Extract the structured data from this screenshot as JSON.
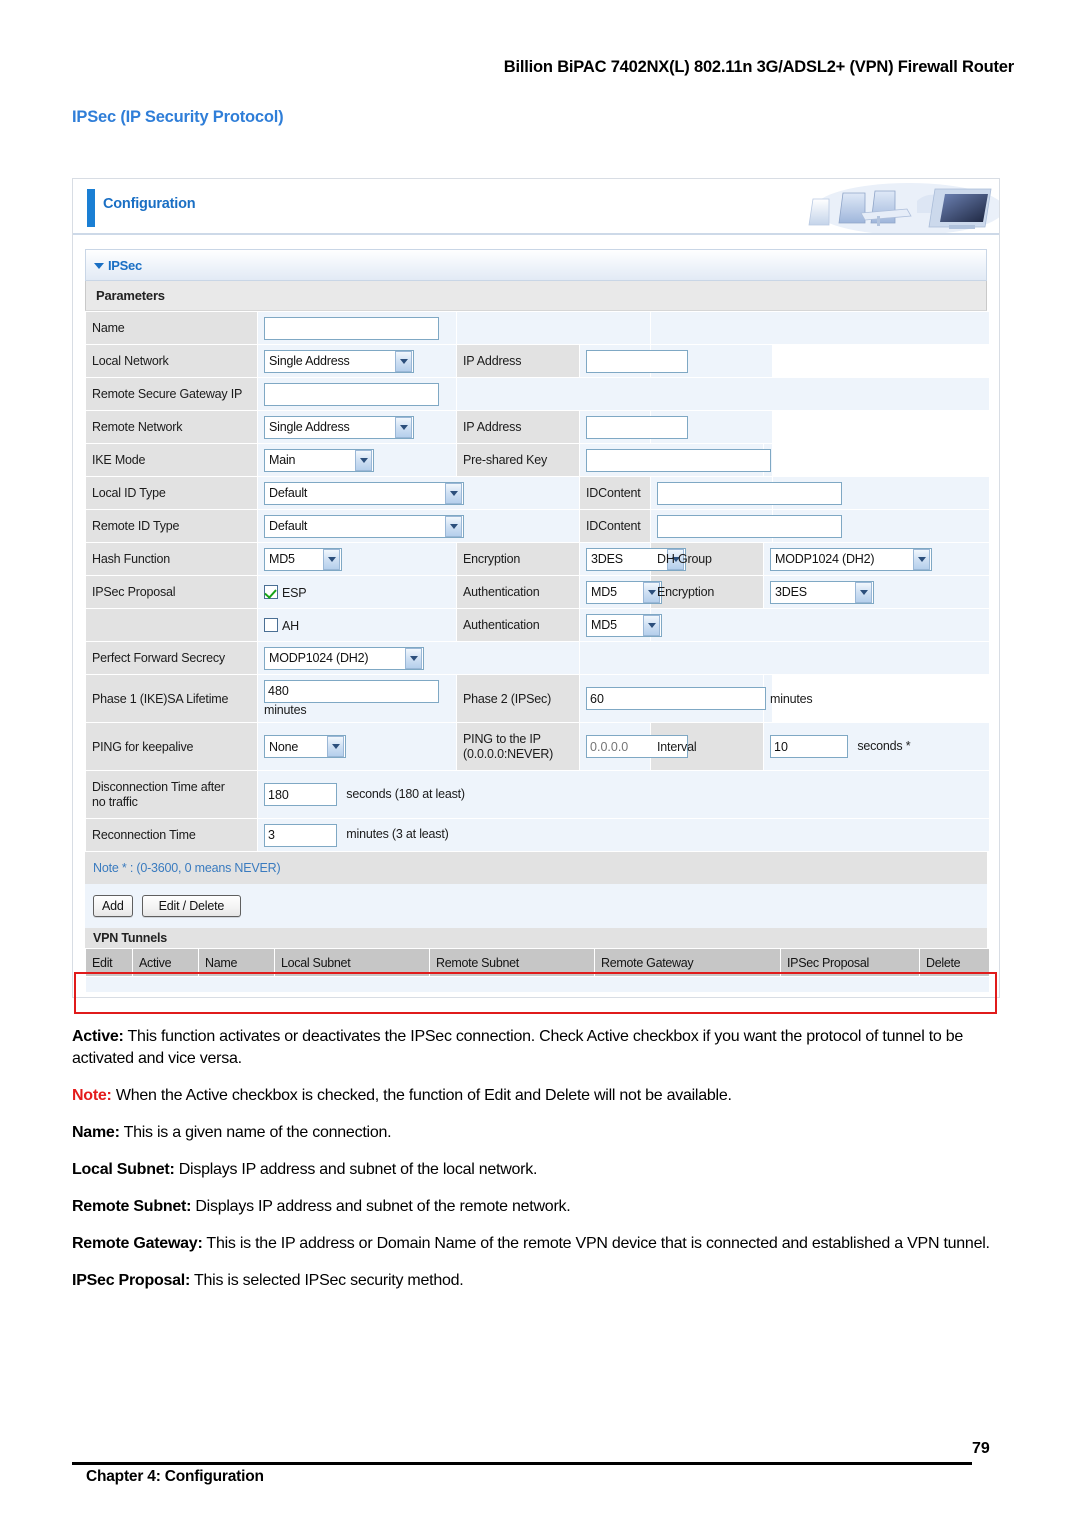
{
  "page": {
    "header_title": "Billion BiPAC 7402NX(L) 802.11n 3G/ADSL2+ (VPN) Firewall Router",
    "section_title": "IPSec (IP Security Protocol)",
    "footer_chapter": "Chapter 4: Configuration",
    "footer_page": "79"
  },
  "panel": {
    "config_label": "Configuration",
    "ipsec_label": "IPSec",
    "parameters_label": "Parameters",
    "note_label": "Note * : (0-3600, 0 means NEVER)",
    "tunnels_label": "VPN Tunnels"
  },
  "form": {
    "name": {
      "label": "Name",
      "value": ""
    },
    "local_network": {
      "label": "Local Network",
      "select_value": "Single Address",
      "ip_label": "IP Address",
      "ip_value": ""
    },
    "remote_secure_gateway_ip": {
      "label": "Remote Secure Gateway IP",
      "value": ""
    },
    "remote_network": {
      "label": "Remote Network",
      "select_value": "Single Address",
      "ip_label": "IP Address",
      "ip_value": ""
    },
    "ike_mode": {
      "label": "IKE Mode",
      "select_value": "Main",
      "psk_label": "Pre-shared Key",
      "psk_value": ""
    },
    "local_id_type": {
      "label": "Local ID Type",
      "select_value": "Default",
      "idcontent_label": "IDContent",
      "idcontent_value": ""
    },
    "remote_id_type": {
      "label": "Remote ID Type",
      "select_value": "Default",
      "idcontent_label": "IDContent",
      "idcontent_value": ""
    },
    "hash_function": {
      "label": "Hash Function",
      "select_value": "MD5",
      "encryption_label": "Encryption",
      "encryption_value": "3DES",
      "dh_group_label": "DH Group",
      "dh_group_value": "MODP1024 (DH2)"
    },
    "ipsec_proposal": {
      "label": "IPSec Proposal",
      "esp_label": "ESP",
      "esp_checked": true,
      "esp_auth_label": "Authentication",
      "esp_auth_value": "MD5",
      "esp_enc_label": "Encryption",
      "esp_enc_value": "3DES",
      "ah_label": "AH",
      "ah_checked": false,
      "ah_auth_label": "Authentication",
      "ah_auth_value": "MD5"
    },
    "pfs": {
      "label": "Perfect Forward Secrecy",
      "select_value": "MODP1024 (DH2)"
    },
    "phase1": {
      "label": "Phase 1 (IKE)SA Lifetime",
      "value": "480",
      "unit": "minutes",
      "phase2_label": "Phase 2 (IPSec)",
      "phase2_value": "60",
      "phase2_unit": "minutes"
    },
    "ping_keepalive": {
      "label": "PING for keepalive",
      "select_value": "None",
      "ping_ip_label_line1": "PING to the IP",
      "ping_ip_label_line2": "(0.0.0.0:NEVER)",
      "ping_ip_placeholder": "0.0.0.0",
      "ping_ip_value": "",
      "interval_label": "Interval",
      "interval_value": "10",
      "interval_unit": "seconds *"
    },
    "disconnection_time": {
      "label_line1": "Disconnection Time after",
      "label_line2": "no traffic",
      "value": "180",
      "unit": "seconds (180 at least)"
    },
    "reconnection_time": {
      "label": "Reconnection Time",
      "value": "3",
      "unit": "minutes (3 at least)"
    }
  },
  "buttons": {
    "add": "Add",
    "edit_delete": "Edit / Delete"
  },
  "tunnels_table": {
    "columns": [
      "Edit",
      "Active",
      "Name",
      "Local Subnet",
      "Remote Subnet",
      "Remote Gateway",
      "IPSec Proposal",
      "Delete"
    ]
  },
  "descriptions": [
    {
      "term": "Active:",
      "term_color": "#000000",
      "text": " This function activates or deactivates the IPSec connection.   Check Active checkbox if you want the protocol of tunnel to be activated and vice versa."
    },
    {
      "term": "Note:",
      "term_color": "#e41b1b",
      "text": " When the Active checkbox is checked, the function of Edit and Delete will not be available."
    },
    {
      "term": "Name:",
      "term_color": "#000000",
      "text": " This is a given name of the connection."
    },
    {
      "term": "Local Subnet:",
      "term_color": "#000000",
      "text": " Displays IP address and subnet of the local network."
    },
    {
      "term": "Remote Subnet:",
      "term_color": "#000000",
      "text": " Displays IP address and subnet of the remote network."
    },
    {
      "term": "Remote Gateway:",
      "term_color": "#000000",
      "text": " This is the IP address or Domain Name of the remote VPN device that is connected and established a VPN tunnel."
    },
    {
      "term": "IPSec Proposal:",
      "term_color": "#000000",
      "text": " This is selected IPSec security method."
    }
  ],
  "colors": {
    "accent_blue": "#1a6fc4",
    "annotation_red": "#e01b1b",
    "label_grey": "#e2e2e2",
    "field_blue": "#eef4fb",
    "table_header_grey": "#c6c6c6"
  }
}
